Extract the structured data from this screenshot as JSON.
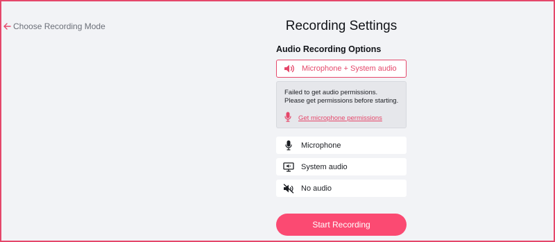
{
  "nav": {
    "back_label": "Choose Recording Mode",
    "back_icon": "arrow-left-icon"
  },
  "page": {
    "title": "Recording Settings",
    "section_title": "Audio Recording Options"
  },
  "options": {
    "selected": {
      "label": "Microphone + System audio",
      "icon": "speaker-icon"
    },
    "microphone": {
      "label": "Microphone",
      "icon": "microphone-icon"
    },
    "system_audio": {
      "label": "System audio",
      "icon": "monitor-audio-icon"
    },
    "no_audio": {
      "label": "No audio",
      "icon": "muted-speaker-icon"
    }
  },
  "warning": {
    "message": "Failed to get audio permissions. Please get permissions before starting.",
    "link_label": "Get microphone permissions",
    "link_icon": "microphone-icon"
  },
  "actions": {
    "start_label": "Start Recording"
  },
  "colors": {
    "accent": "#e5476a",
    "button": "#fb4a72",
    "background": "#f2f3f6",
    "warning_bg": "#e6e7eb"
  }
}
